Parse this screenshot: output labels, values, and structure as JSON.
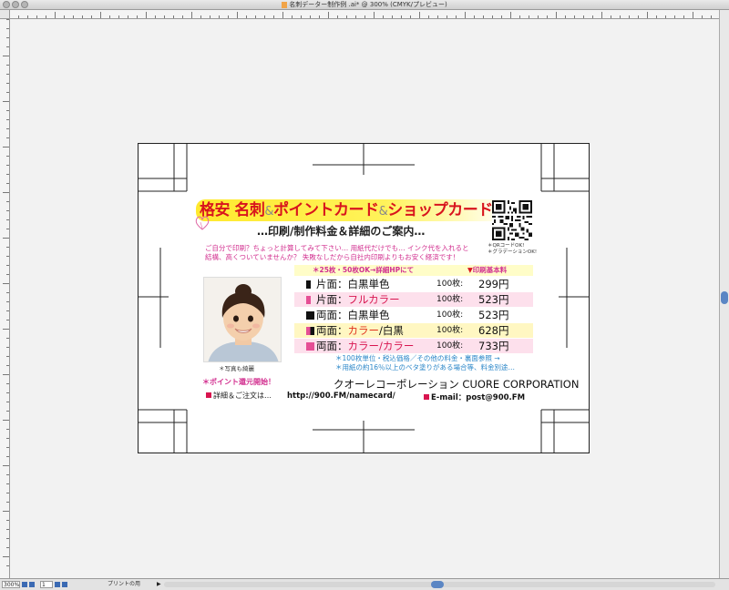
{
  "window": {
    "title": "名刺データー制作例 .ai* @ 300% (CMYK/プレビュー)"
  },
  "status_bar": {
    "zoom": "300%",
    "page": "1",
    "mode": "プリントの用"
  },
  "card": {
    "headline": {
      "part1": "格安",
      "part2": "名刺",
      "amp": "&",
      "part3": "ポイントカード",
      "part4": "ショップカード！"
    },
    "subheadline": "…印刷/制作料金＆詳細のご案内…",
    "intro_line1": "ご自分で印刷？ちょっと計算してみて下さい… 用紙代だけでも… インク代を入れると",
    "intro_line2": "結構、高くついていませんか？ 失敗なしだから自社内印刷よりもお安く経済です！",
    "qr_note_line1": "＊QRコードOK!",
    "qr_note_line2": "＊グラデーションOK!",
    "photo_caption": "＊写真も綺麗",
    "point_note": "＊ポイント還元開始！",
    "detail_note": "詳細＆ご注文は…",
    "price_header_left": "＊25枚・50枚OK→詳細HPにて",
    "price_header_right": "印刷基本料",
    "price_rows": [
      {
        "label_a": "片面：",
        "label_b": "白黒単色",
        "count": "100枚:",
        "price": "299円"
      },
      {
        "label_a": "片面：",
        "label_b": "フルカラー",
        "count": "100枚:",
        "price": "523円"
      },
      {
        "label_a": "両面：",
        "label_b": "白黒単色",
        "count": "100枚:",
        "price": "523円"
      },
      {
        "label_a": "両面：",
        "label_b": "カラー",
        "label_c": "/白黒",
        "count": "100枚:",
        "price": "628円"
      },
      {
        "label_a": "両面：",
        "label_b": "カラー/カラー",
        "count": "100枚:",
        "price": "733円"
      }
    ],
    "footnote1": "＊100枚単位・税込価格／その他の料金・裏面参照 →",
    "footnote2": "＊用紙の約16％以上のベタ塗りがある場合等、料金別途…",
    "company": "クオーレコーポレーション CUORE CORPORATION",
    "url": "http://900.FM/namecard/",
    "email": "E-mail：post@900.FM"
  },
  "colors": {
    "accent_pink": "#d22f8f",
    "accent_red": "#d8141d",
    "note_blue": "#2a86c8",
    "band_yellow": "#fffdc8",
    "band_pink": "#fde0ec"
  }
}
